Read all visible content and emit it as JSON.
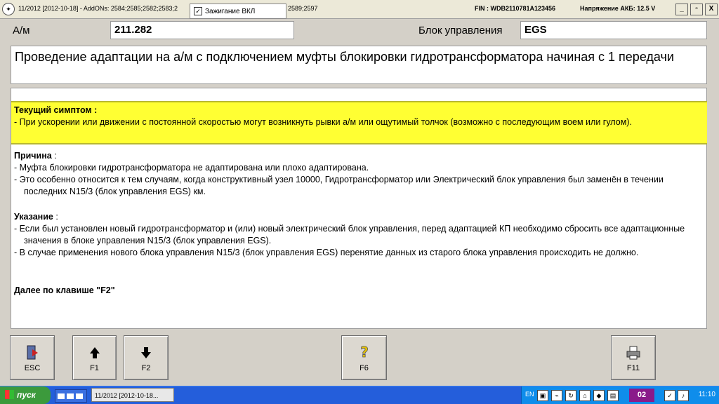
{
  "titlebar": {
    "title": "11/2012 [2012-10-18] - AddONs: 2584;2585;2582;2583;2",
    "title_tail": "2589;2597",
    "ignition_label": "Зажигание ВКЛ",
    "fin": "FIN : WDB2110781A123456",
    "voltage": "Напряжение АКБ: 12.5 V",
    "minimize": "_",
    "restore": "▫",
    "close": "X"
  },
  "header": {
    "car_label": "А/м",
    "car_value": "211.282",
    "ecu_label": "Блок управления",
    "ecu_value": "EGS"
  },
  "procedure_title": "Проведение адаптации на а/м с подключением муфты блокировки гидротрансформатора начиная с 1 передачи",
  "content": {
    "symptom_head": "Текущий симптом :",
    "symptom_item": "- При ускорении или движении с постоянной скоростью могут возникнуть рывки а/м или ощутимый толчок (возможно с последующим воем или гулом).",
    "cause_head": "Причина",
    "cause_colon": " :",
    "cause_items": [
      "- Муфта блокировки гидротрансформатора не адаптирована или плохо адаптирована.",
      "- Это особенно относится к тем случаям, когда конструктивный узел 10000, Гидротрансформатор или Электрический блок управления был заменён в течении последних N15/3 (блок управления EGS) км."
    ],
    "note_head": "Указание",
    "note_colon": " :",
    "note_items": [
      "- Если был установлен новый гидротрансформатор и (или) новый электрический блок управления, перед адаптацией КП необходимо сбросить все адаптационные значения в блоке управления N15/3 (блок управления EGS).",
      "- В случае применения нового блока управления N15/3 (блок управления EGS) перенятие данных из старого блока управления происходить не должно."
    ],
    "continue": "Далее по клавише \"F2\""
  },
  "buttons": [
    {
      "key": "ESC",
      "icon": "exit-door-icon"
    },
    {
      "key": "F1",
      "icon": "arrow-up-icon"
    },
    {
      "key": "F2",
      "icon": "arrow-down-icon"
    },
    {
      "key": "F6",
      "icon": "help-icon"
    },
    {
      "key": "F11",
      "icon": "printer-icon"
    }
  ],
  "taskbar": {
    "start": "пуск",
    "task": "11/2012 [2012-10-18...",
    "lang": "EN",
    "desktop_num": "02",
    "clock": "11:10"
  },
  "colors": {
    "symptom_bg": "#ffff33",
    "window_bg": "#d4d0c8",
    "taskbar": "#245edb"
  }
}
